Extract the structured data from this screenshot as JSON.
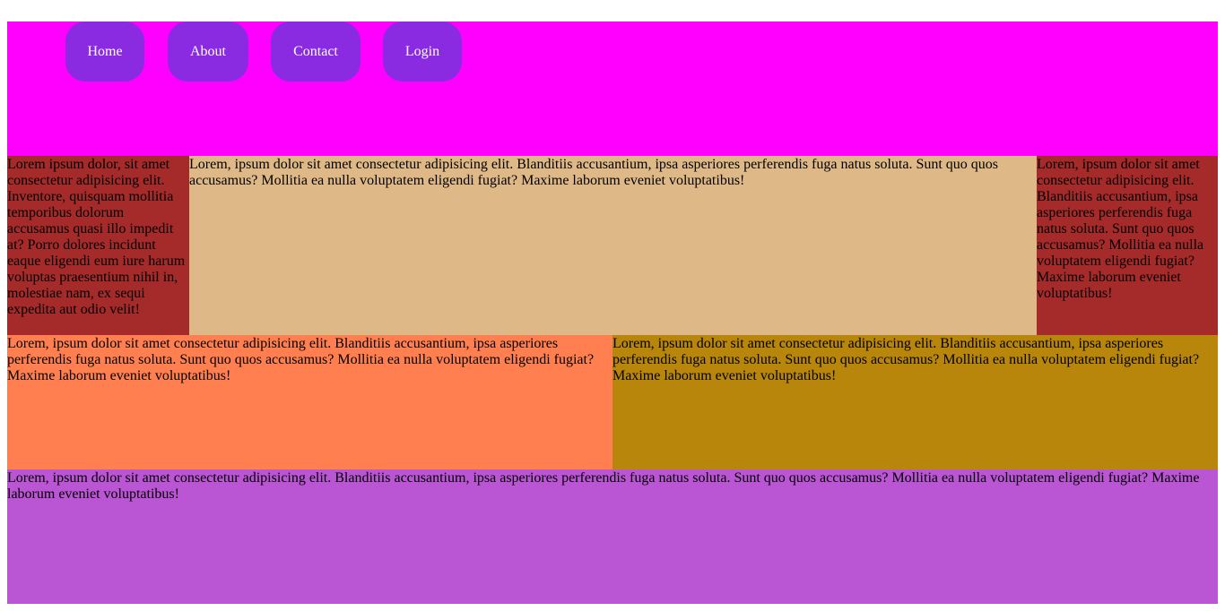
{
  "nav": {
    "items": [
      {
        "label": "Home"
      },
      {
        "label": "About"
      },
      {
        "label": "Contact"
      },
      {
        "label": "Login"
      }
    ]
  },
  "sections": {
    "left_sidebar": "Lorem ipsum dolor, sit amet consectetur adipisicing elit. Inventore, quisquam mollitia temporibus dolorum accusamus quasi illo impedit at? Porro dolores incidunt eaque eligendi eum iure harum voluptas praesentium nihil in, molestiae nam, ex sequi expedita aut odio velit!",
    "main": "Lorem, ipsum dolor sit amet consectetur adipisicing elit. Blanditiis accusantium, ipsa asperiores perferendis fuga natus soluta. Sunt quo quos accusamus? Mollitia ea nulla voluptatem eligendi fugiat? Maxime laborum eveniet voluptatibus!",
    "right_sidebar": "Lorem, ipsum dolor sit amet consectetur adipisicing elit. Blanditiis accusantium, ipsa asperiores perferendis fuga natus soluta. Sunt quo quos accusamus? Mollitia ea nulla voluptatem eligendi fugiat? Maxime laborum eveniet voluptatibus!",
    "content_left": "Lorem, ipsum dolor sit amet consectetur adipisicing elit. Blanditiis accusantium, ipsa asperiores perferendis fuga natus soluta. Sunt quo quos accusamus? Mollitia ea nulla voluptatem eligendi fugiat? Maxime laborum eveniet voluptatibus!",
    "content_right": "Lorem, ipsum dolor sit amet consectetur adipisicing elit. Blanditiis accusantium, ipsa asperiores perferendis fuga natus soluta. Sunt quo quos accusamus? Mollitia ea nulla voluptatem eligendi fugiat? Maxime laborum eveniet voluptatibus!",
    "footer": "Lorem, ipsum dolor sit amet consectetur adipisicing elit. Blanditiis accusantium, ipsa asperiores perferendis fuga natus soluta. Sunt quo quos accusamus? Mollitia ea nulla voluptatem eligendi fugiat? Maxime laborum eveniet voluptatibus!"
  },
  "colors": {
    "header": "#ff00ff",
    "nav_button": "#8a2be2",
    "left_sidebar": "#a52a2a",
    "main": "#deb887",
    "right_sidebar": "#a52a2a",
    "content_left": "#ff7f50",
    "content_right": "#b8860b",
    "footer": "#ba55d3"
  }
}
